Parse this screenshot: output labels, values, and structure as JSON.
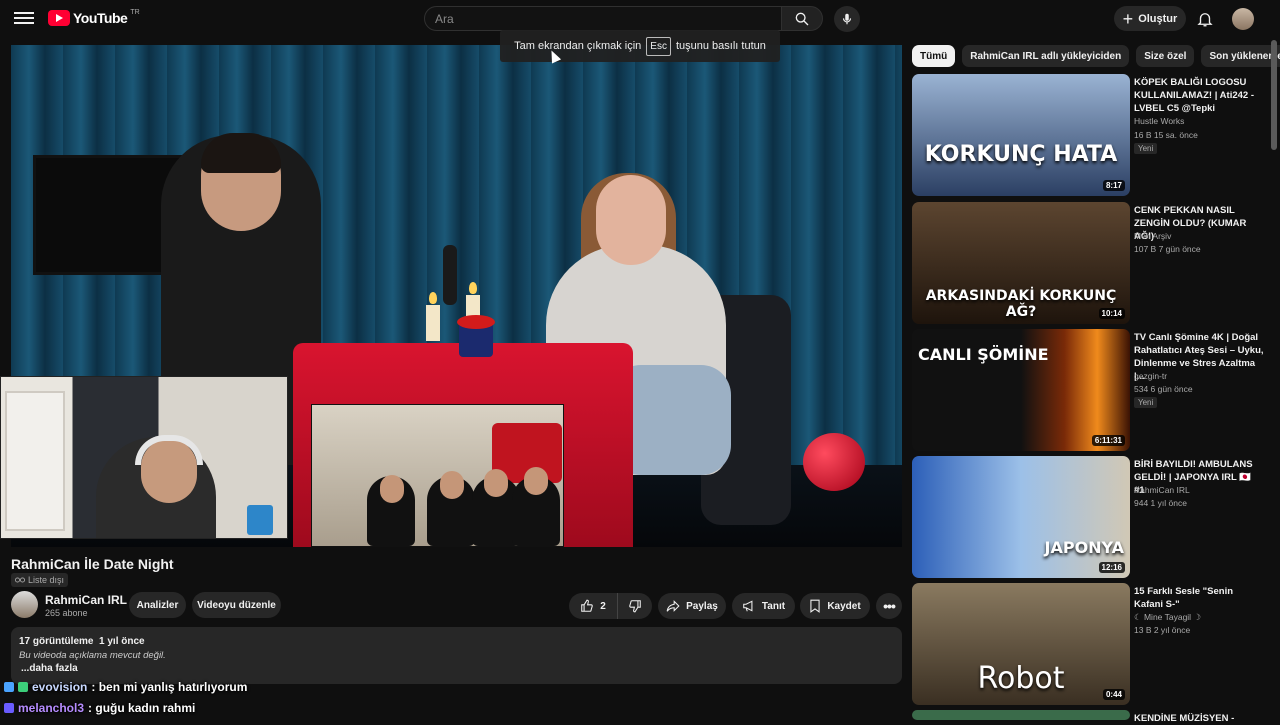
{
  "header": {
    "logo_text": "YouTube",
    "logo_country": "TR",
    "search_placeholder": "Ara",
    "create_label": "Oluştur"
  },
  "tooltip": {
    "before": "Tam ekrandan çıkmak için",
    "key": "Esc",
    "after": "tuşunu basılı tutun"
  },
  "video": {
    "title": "RahmiCan İle Date Night",
    "visibility": "Liste dışı",
    "channel": "RahmiCan IRL",
    "subscribers": "265 abone",
    "analytics_label": "Analizler",
    "edit_label": "Videoyu düzenle",
    "likes": "2",
    "share_label": "Paylaş",
    "promote_label": "Tanıt",
    "save_label": "Kaydet",
    "views_date": "17 görüntüleme  1 yıl önce",
    "description": "Bu videoda açıklama mevcut değil.",
    "more_label": "...daha fazla"
  },
  "chat": [
    {
      "user": "evovision",
      "text": ": ben mi yanlış hatırlıyorum"
    },
    {
      "user": "melanchol3",
      "text": ": guğu kadın rahmi"
    }
  ],
  "chips": [
    "Tümü",
    "RahmiCan IRL adlı yükleyiciden",
    "Size özel",
    "Son yüklenenler"
  ],
  "recommendations": [
    {
      "title": "KÖPEK BALIĞI LOGOSU KULLANILAMAZ! | Ati242 - LVBEL C5 @Tepki",
      "channel": "Hustle Works",
      "meta": "16 B  15 sa. önce",
      "badge": "Yeni",
      "duration": "8:17",
      "thumb_text": "KORKUNÇ HATA"
    },
    {
      "title": "CENK PEKKAN NASIL ZENGİN OLDU? (KUMAR AĞI)",
      "channel": "Meh Arşiv",
      "meta": "107 B  7 gün önce",
      "badge": "",
      "duration": "10:14",
      "thumb_text": "ARKASINDAKİ KORKUNÇ AĞ?"
    },
    {
      "title": "TV Canlı Şömine 4K | Doğal Rahatlatıcı Ateş Sesi – Uyku, Dinlenme ve Stres Azaltma |...",
      "channel": "gezgin-tr",
      "meta": "534  6 gün önce",
      "badge": "Yeni",
      "duration": "6:11:31",
      "thumb_text": "CANLI ŞÖMİNE"
    },
    {
      "title": "BİRİ BAYILDI! AMBULANS GELDİ! | JAPONYA IRL 🇯🇵 #1",
      "channel": "RahmiCan IRL",
      "meta": "944  1 yıl önce",
      "badge": "",
      "duration": "12:16",
      "thumb_text": "JAPONYA"
    },
    {
      "title": "15 Farklı Sesle \"Senin Kafani S-\"",
      "channel": "☾ Mine Tayagil ☽",
      "meta": "13 B  2 yıl önce",
      "badge": "",
      "duration": "0:44",
      "thumb_text": "Robot"
    },
    {
      "title": "KENDİNE MÜZİSYEN -",
      "channel": "",
      "meta": "",
      "badge": "",
      "duration": "",
      "thumb_text": ""
    }
  ],
  "colors": {
    "background": "#0f0f0f",
    "youtube_red": "#ff0033",
    "pill_bg": "#272727"
  },
  "icons": [
    "menu-icon",
    "search-icon",
    "mic-icon",
    "plus-icon",
    "bell-icon",
    "link-icon",
    "like-icon",
    "dislike-icon",
    "share-icon",
    "megaphone-icon",
    "bookmark-icon",
    "more-icon"
  ]
}
